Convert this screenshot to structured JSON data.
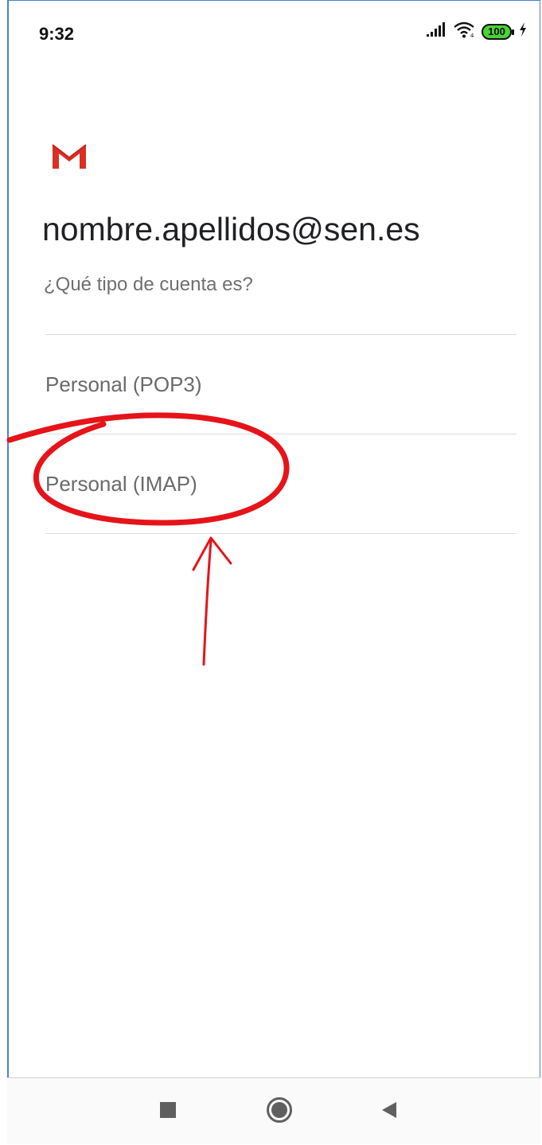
{
  "status_bar": {
    "time": "9:32",
    "battery_level": "100",
    "icons": [
      "signal-icon",
      "wifi-icon",
      "battery-icon",
      "charging-icon"
    ]
  },
  "header": {
    "app_icon": "gmail-icon",
    "account_email": "nombre.apellidos@sen.es",
    "question": "¿Qué tipo de cuenta es?"
  },
  "options": [
    {
      "label": "Personal (POP3)"
    },
    {
      "label": "Personal (IMAP)"
    }
  ],
  "annotation": {
    "highlighted_option": "Personal (IMAP)",
    "color": "#e5141a"
  },
  "nav_bar": {
    "buttons": [
      "recents-square-icon",
      "home-circle-icon",
      "back-triangle-icon"
    ]
  },
  "colors": {
    "gmail_red": "#d93025",
    "text_primary": "#202124",
    "text_secondary": "#6f6f6f",
    "battery_green": "#4cd137",
    "frame_blue": "#4a7fd6"
  }
}
